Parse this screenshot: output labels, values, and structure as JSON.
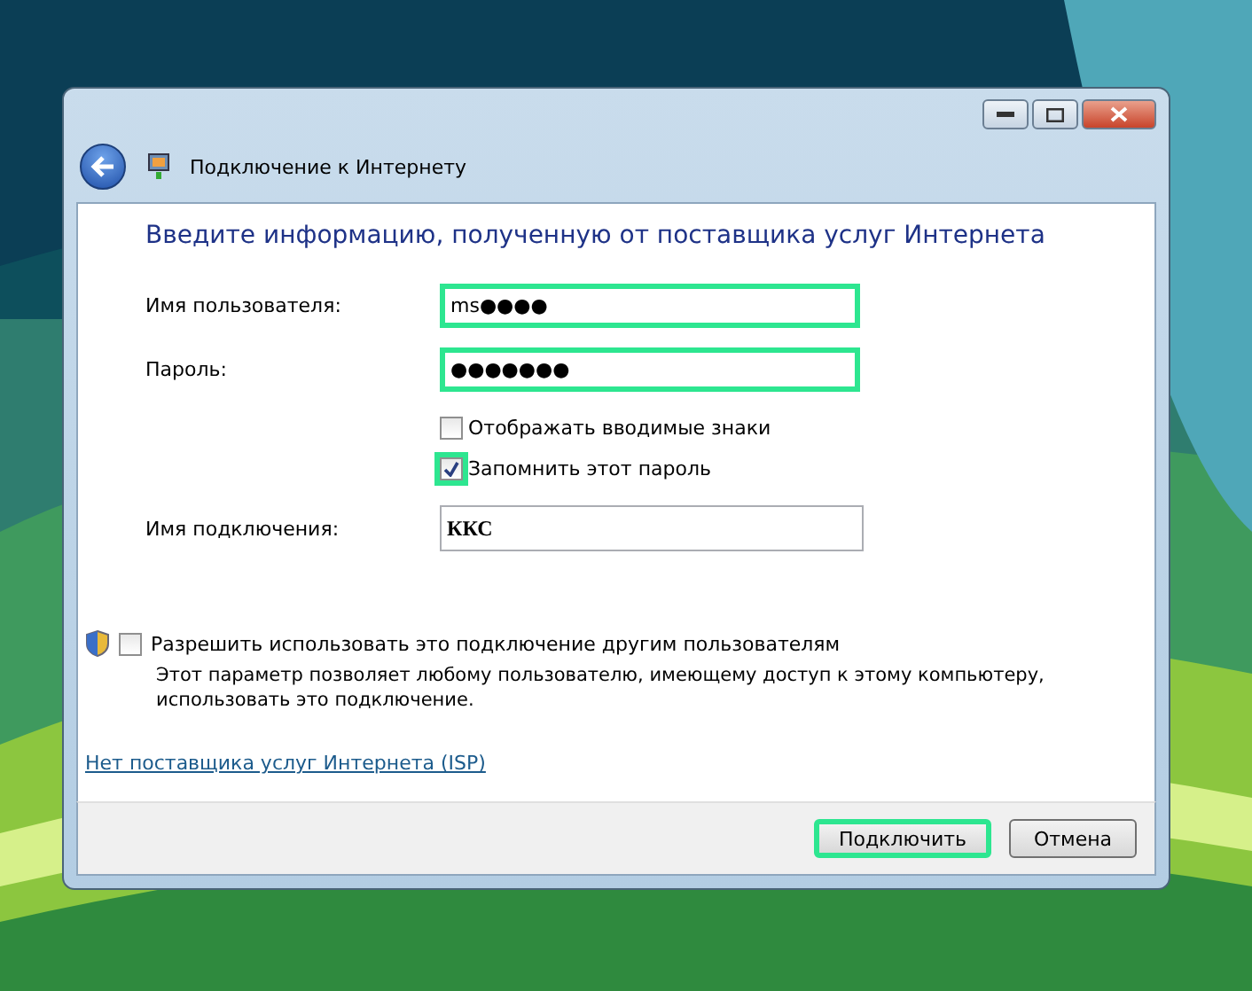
{
  "window": {
    "title": "Подключение к Интернету"
  },
  "heading": "Введите информацию, полученную от поставщика услуг Интернета",
  "fields": [
    {
      "label": "Имя пользователя:",
      "value": "ms●●●●",
      "highlighted": true
    },
    {
      "label": "Пароль:",
      "value": "●●●●●●●",
      "highlighted": true
    }
  ],
  "password_options": [
    {
      "label": "Отображать вводимые знаки",
      "checked": false,
      "highlighted": false
    },
    {
      "label": "Запомнить этот пароль",
      "checked": true,
      "highlighted": true
    }
  ],
  "connection_name": {
    "label": "Имя подключения:",
    "value": "ККС"
  },
  "share": {
    "label": "Разрешить использовать это подключение другим пользователям",
    "checked": false,
    "description": "Этот параметр позволяет любому пользователю, имеющему доступ к этому компьютеру, использовать это подключение."
  },
  "link": "Нет поставщика услуг Интернета (ISP)",
  "buttons": [
    {
      "label": "Подключить",
      "highlighted": true
    },
    {
      "label": "Отмена",
      "highlighted": false
    }
  ]
}
